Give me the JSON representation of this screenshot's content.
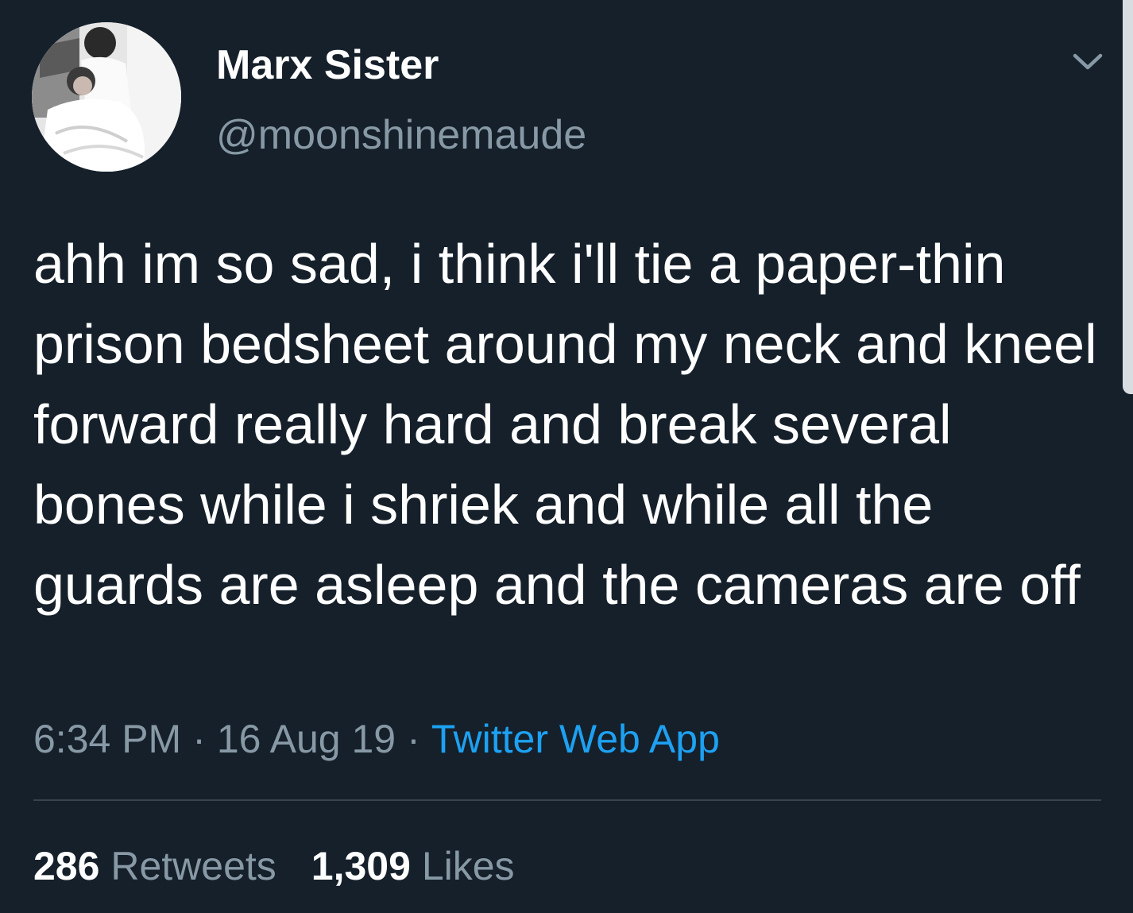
{
  "author": {
    "display_name": "Marx Sister",
    "handle": "@moonshinemaude"
  },
  "tweet": {
    "text": "ahh im so sad, i think i'll tie a paper-thin prison bedsheet around my neck and kneel forward really hard and break several bones while i shriek and while all the guards are asleep and the cameras are off",
    "time": "6:34 PM",
    "separator": "·",
    "date": "16 Aug 19",
    "source": "Twitter Web App"
  },
  "stats": {
    "retweets_count": "286",
    "retweets_label": "Retweets",
    "likes_count": "1,309",
    "likes_label": "Likes"
  },
  "colors": {
    "background": "#15202b",
    "secondary_text": "#8899a6",
    "accent": "#1da1f2"
  },
  "icons": {
    "menu": "chevron-down-icon"
  }
}
